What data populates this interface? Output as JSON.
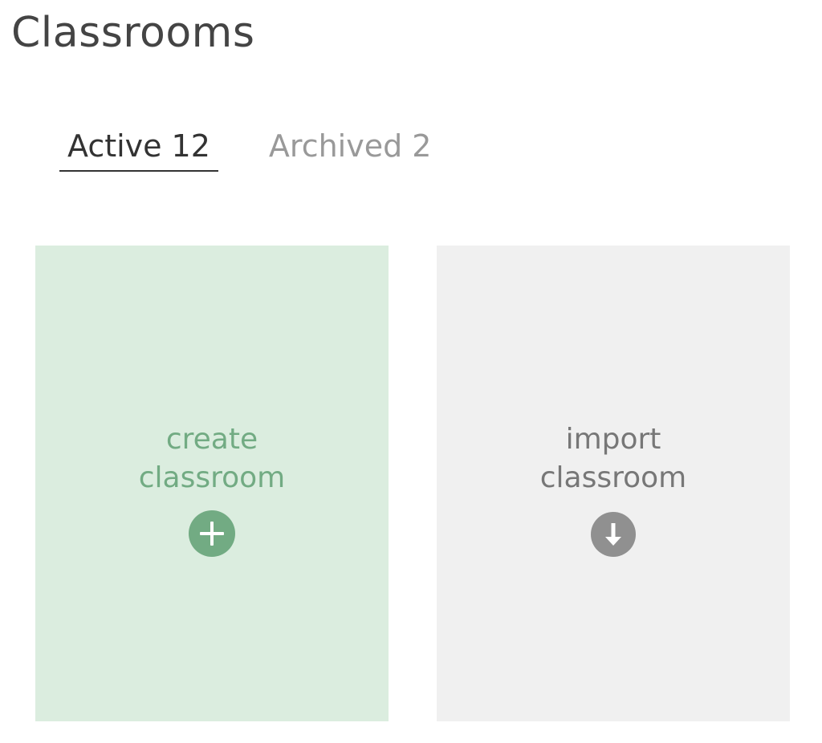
{
  "header": {
    "title": "Classrooms"
  },
  "tabs": [
    {
      "label": "Active",
      "count": "12",
      "active": true
    },
    {
      "label": "Archived",
      "count": "2",
      "active": false
    }
  ],
  "cards": {
    "create": {
      "line1": "create",
      "line2": "classroom",
      "icon": "plus-circle-icon"
    },
    "import": {
      "line1": "import",
      "line2": "classroom",
      "icon": "download-arrow-circle-icon"
    }
  },
  "colors": {
    "create_bg": "#dbeddf",
    "create_accent": "#72ab83",
    "import_bg": "#f0f0f0",
    "import_accent": "#909090",
    "title_text": "#444444"
  }
}
